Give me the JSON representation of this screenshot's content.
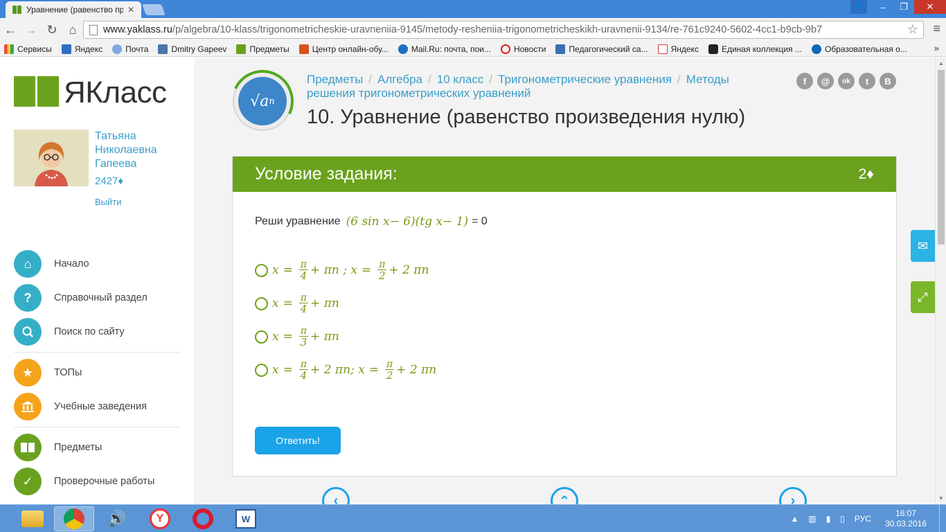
{
  "browser": {
    "tab_title": "Уравнение (равенство пр",
    "url_host": "www.yaklass.ru",
    "url_path": "/p/algebra/10-klass/trigonometricheskie-uravneniia-9145/metody-resheniia-trigonometricheskikh-uravnenii-9134/re-761c9240-5602-4cc1-b9cb-9b7",
    "bookmarks": [
      "Сервисы",
      "Яндекс",
      "Почта",
      "Dmitry Gapeev",
      "Предметы",
      "Центр онлайн-обу...",
      "Mail.Ru: почта, пои...",
      "Новости",
      "Педагогический са...",
      "Яндекс",
      "Единая коллекция ...",
      "Образовательная о..."
    ],
    "bookmark_more": "»"
  },
  "sidebar": {
    "logo_text": "ЯКласс",
    "user_name": "Татьяна Николаевна Гапеева",
    "points": "2427♦",
    "logout": "Выйти",
    "nav": [
      {
        "label": "Начало",
        "icon": "home-icon",
        "color": "#35afc7"
      },
      {
        "label": "Справочный раздел",
        "icon": "question-icon",
        "color": "#35afc7"
      },
      {
        "label": "Поиск по сайту",
        "icon": "search-icon",
        "color": "#35afc7"
      },
      {
        "label": "ТОПы",
        "icon": "star-icon",
        "color": "#f5a31a"
      },
      {
        "label": "Учебные заведения",
        "icon": "institution-icon",
        "color": "#f5a31a"
      },
      {
        "label": "Предметы",
        "icon": "book-icon",
        "color": "#6aa21e"
      },
      {
        "label": "Проверочные работы",
        "icon": "check-icon",
        "color": "#6aa21e"
      }
    ]
  },
  "breadcrumbs": [
    "Предметы",
    "Алгебра",
    "10 класс",
    "Тригонометрические уравнения",
    "Методы решения тригонометрических уравнений"
  ],
  "page_title": "10. Уравнение (равенство произведения нулю)",
  "social": [
    "f",
    "@",
    "ok",
    "t",
    "B"
  ],
  "task": {
    "header": "Условие задания:",
    "points": "2♦",
    "question_prefix": "Реши уравнение",
    "equation": "(6 sin x− 6)(tg x− 1)",
    "equation_rhs": "= 0",
    "options": [
      "x = π/4 + πn ; x = π/2 + 2 πn",
      "x = π/4 + πn",
      "x = π/3 + πn",
      "x = π/4 + 2 πn; x = π/2 + 2 πn"
    ],
    "submit": "Ответить!"
  },
  "taskbar": {
    "lang": "РУС",
    "time": "16:07",
    "date": "30.03.2016"
  }
}
